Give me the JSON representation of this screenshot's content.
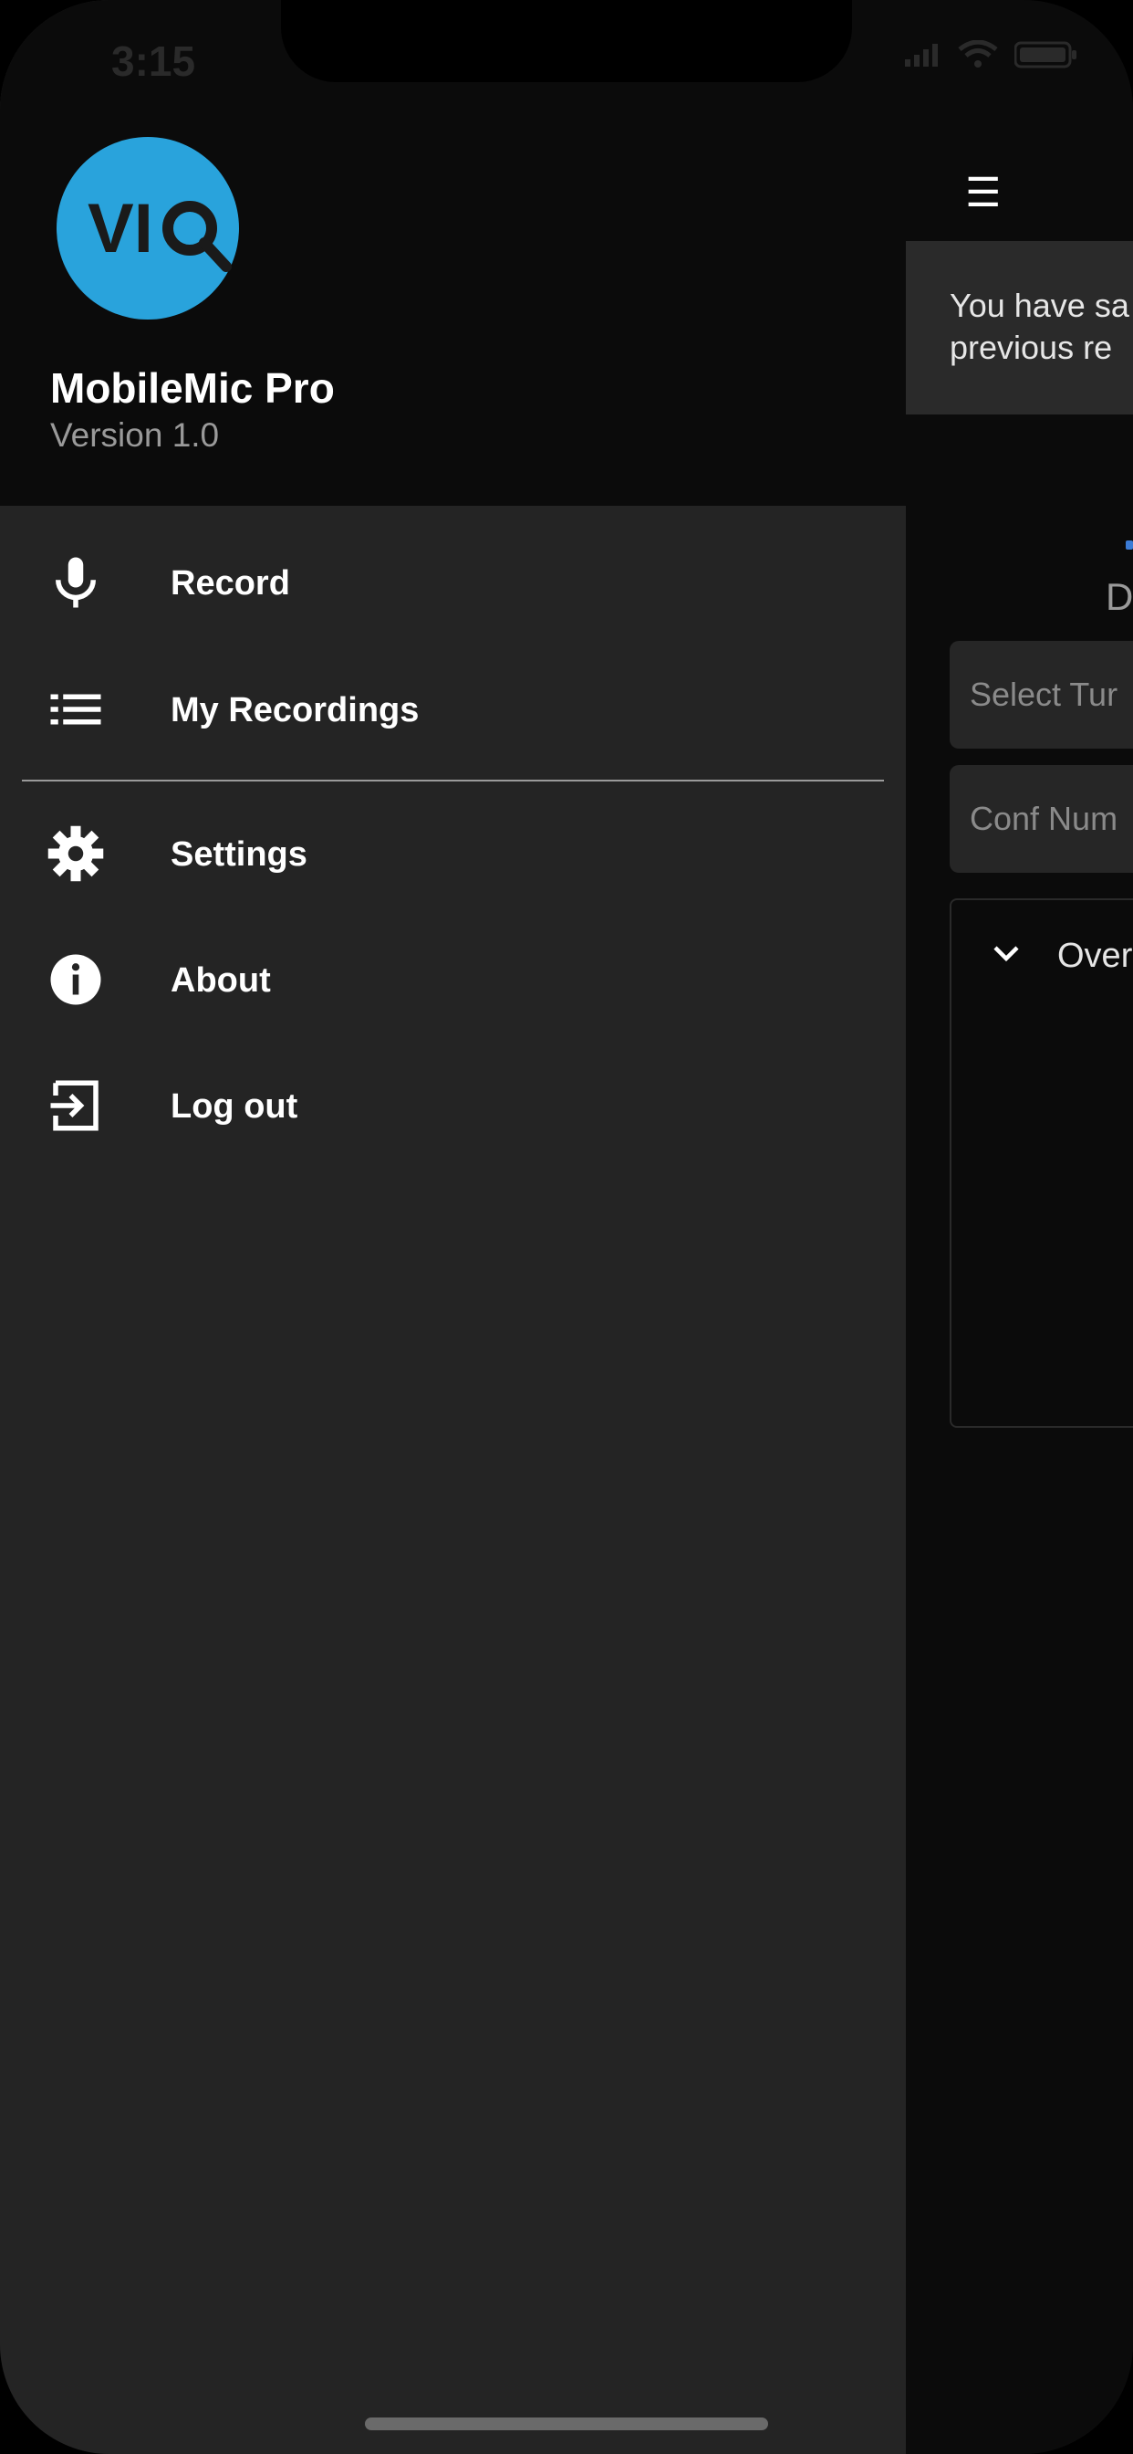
{
  "status_bar": {
    "time": "3:15"
  },
  "drawer": {
    "app_name": "MobileMic Pro",
    "version": "Version 1.0",
    "menu_primary": [
      {
        "label": "Record",
        "icon": "microphone-icon"
      },
      {
        "label": "My Recordings",
        "icon": "list-icon"
      }
    ],
    "menu_secondary": [
      {
        "label": "Settings",
        "icon": "gear-icon"
      },
      {
        "label": "About",
        "icon": "info-icon"
      },
      {
        "label": "Log out",
        "icon": "logout-icon"
      }
    ]
  },
  "main": {
    "menu_icon": "hamburger-icon",
    "banner_line1": "You have sa",
    "banner_line2": "previous re",
    "section_label": "D",
    "select_placeholder": "Select Tur",
    "conf_placeholder": "Conf Num",
    "panel_title": "Over"
  },
  "colors": {
    "accent_logo": "#29a3dc",
    "drawer_bg": "#242424",
    "header_bg": "#0b0b0b"
  }
}
